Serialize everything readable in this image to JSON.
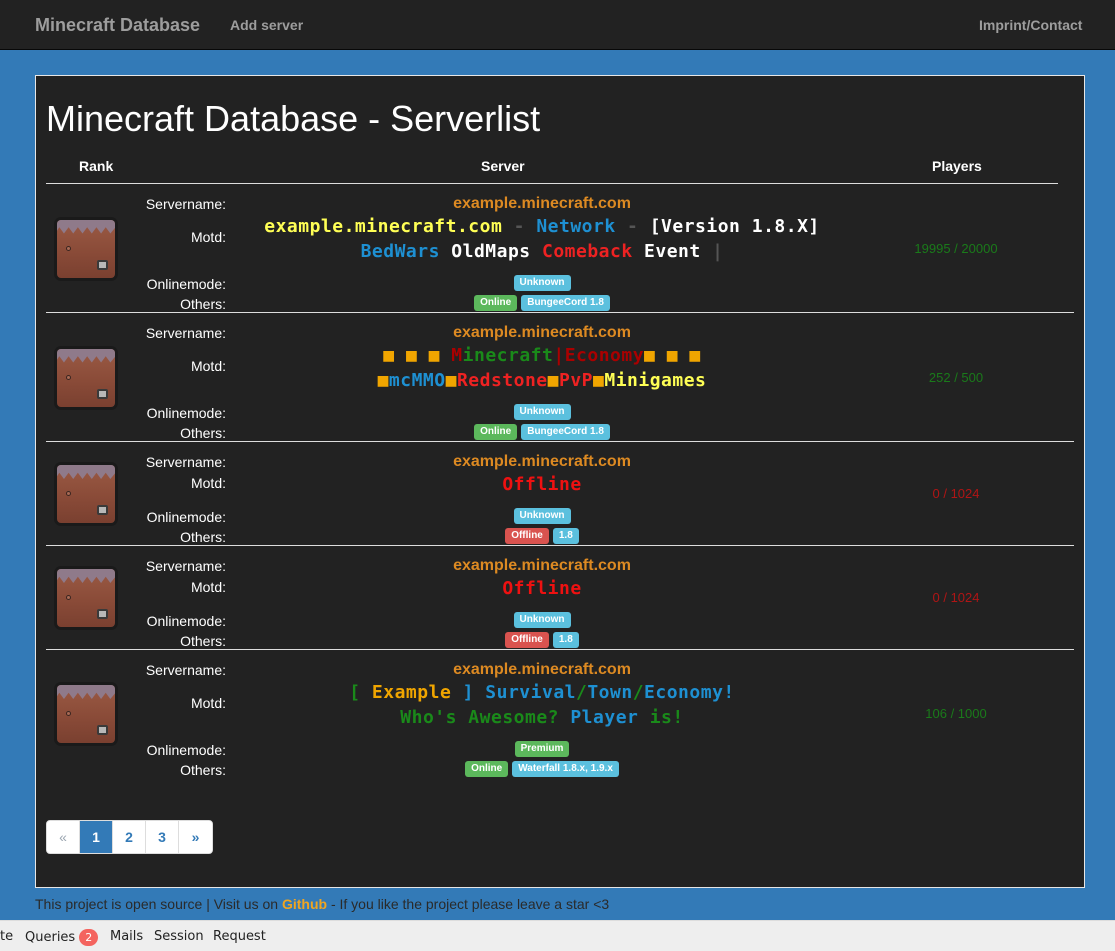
{
  "navbar": {
    "brand": "Minecraft Database",
    "add_server": "Add server",
    "imprint": "Imprint/Contact"
  },
  "page": {
    "title": "Minecraft Database - Serverlist",
    "headers": {
      "rank": "Rank",
      "server": "Server",
      "players": "Players"
    }
  },
  "labels": {
    "servername": "Servername:",
    "motd": "Motd:",
    "onlinemode": "Onlinemode:",
    "others": "Others:"
  },
  "servers": [
    {
      "name": "example.minecraft.com",
      "motd": [
        [
          {
            "t": "example.minecraft.com",
            "c": "#ffff55"
          },
          {
            "t": " - ",
            "c": "#555555"
          },
          {
            "t": "Network",
            "c": "#1e90d2"
          },
          {
            "t": " - ",
            "c": "#555555"
          },
          {
            "t": "[Version 1.8.X]",
            "c": "#ffffff"
          }
        ],
        [
          {
            "t": "BedWars ",
            "c": "#1e90d2"
          },
          {
            "t": "OldMaps ",
            "c": "#ffffff"
          },
          {
            "t": "Comeback ",
            "c": "#ee2222"
          },
          {
            "t": "Event ",
            "c": "#ffffff"
          },
          {
            "t": "|",
            "c": "#555555"
          }
        ]
      ],
      "onlinemode": {
        "text": "Unknown",
        "color": "info"
      },
      "status": {
        "text": "Online",
        "color": "success"
      },
      "version": "BungeeCord 1.8",
      "players": "19995 / 20000",
      "players_color": "#1a7a1a"
    },
    {
      "name": "example.minecraft.com",
      "motd": [
        [
          {
            "t": "■ ■ ■ ",
            "c": "#f0a500"
          },
          {
            "t": "M",
            "c": "#aa0000"
          },
          {
            "t": "inecraft",
            "c": "#1a8a1a"
          },
          {
            "t": "|",
            "c": "#aa0000"
          },
          {
            "t": "Economy",
            "c": "#aa0000"
          },
          {
            "t": "■ ■ ■",
            "c": "#f0a500"
          }
        ],
        [
          {
            "t": "■",
            "c": "#f0a500"
          },
          {
            "t": "mcMMO",
            "c": "#1e90d2"
          },
          {
            "t": "■",
            "c": "#f0a500"
          },
          {
            "t": "Redstone",
            "c": "#ee2222"
          },
          {
            "t": "■",
            "c": "#f0a500"
          },
          {
            "t": "PvP",
            "c": "#ee2222"
          },
          {
            "t": "■",
            "c": "#f0a500"
          },
          {
            "t": "Minigames",
            "c": "#ffff55"
          }
        ]
      ],
      "onlinemode": {
        "text": "Unknown",
        "color": "info"
      },
      "status": {
        "text": "Online",
        "color": "success"
      },
      "version": "BungeeCord 1.8",
      "players": "252 / 500",
      "players_color": "#1a7a1a"
    },
    {
      "name": "example.minecraft.com",
      "motd": [
        [
          {
            "t": "Offline",
            "c": "#ee1111"
          }
        ]
      ],
      "onlinemode": {
        "text": "Unknown",
        "color": "info"
      },
      "status": {
        "text": "Offline",
        "color": "danger"
      },
      "version": "1.8",
      "players": "0 / 1024",
      "players_color": "#b01515"
    },
    {
      "name": "example.minecraft.com",
      "motd": [
        [
          {
            "t": "Offline",
            "c": "#ee1111"
          }
        ]
      ],
      "onlinemode": {
        "text": "Unknown",
        "color": "info"
      },
      "status": {
        "text": "Offline",
        "color": "danger"
      },
      "version": "1.8",
      "players": "0 / 1024",
      "players_color": "#b01515"
    },
    {
      "name": "example.minecraft.com",
      "motd": [
        [
          {
            "t": "[ ",
            "c": "#1a8a1a"
          },
          {
            "t": "Example",
            "c": "#f0a500"
          },
          {
            "t": " ] ",
            "c": "#1e90d2"
          },
          {
            "t": "Survival",
            "c": "#1e90d2"
          },
          {
            "t": "/",
            "c": "#1a8a1a"
          },
          {
            "t": "Town",
            "c": "#1e90d2"
          },
          {
            "t": "/",
            "c": "#1a8a1a"
          },
          {
            "t": "Economy!",
            "c": "#1e90d2"
          }
        ],
        [
          {
            "t": "Who's Awesome? ",
            "c": "#1a8a1a"
          },
          {
            "t": "Player ",
            "c": "#1e90d2"
          },
          {
            "t": "is!",
            "c": "#1a8a1a"
          }
        ]
      ],
      "onlinemode": {
        "text": "Premium",
        "color": "success"
      },
      "status": {
        "text": "Online",
        "color": "success"
      },
      "version": "Waterfall 1.8.x, 1.9.x",
      "players": "106 / 1000",
      "players_color": "#1a7a1a"
    }
  ],
  "pagination": {
    "prev": "«",
    "pages": [
      "1",
      "2",
      "3"
    ],
    "next": "»",
    "active": "1"
  },
  "footer": {
    "text_before": "This project is open source | Visit us on ",
    "link": "Github",
    "text_after": " - If you like the project please leave a star <3"
  },
  "debugbar": {
    "partial": "te",
    "queries": "Queries",
    "queries_count": "2",
    "mails": "Mails",
    "session": "Session",
    "request": "Request"
  }
}
